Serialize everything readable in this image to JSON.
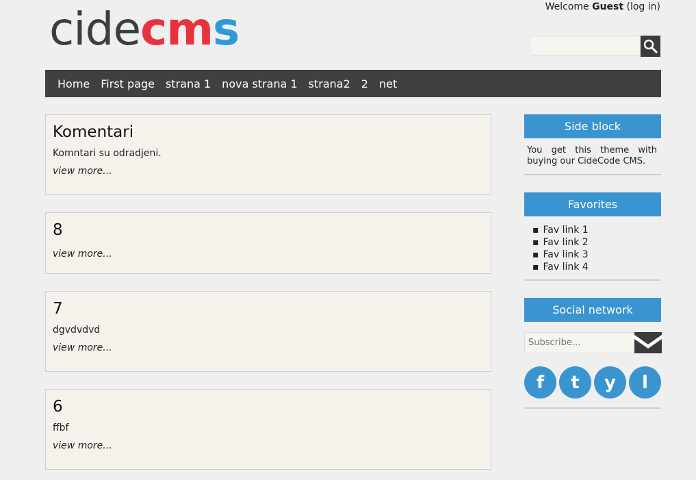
{
  "logo": {
    "part1": "cide",
    "part2": "cm",
    "part3": "s"
  },
  "user": {
    "welcome": "Welcome",
    "name": "Guest",
    "login": "(log in)"
  },
  "search": {
    "placeholder": ""
  },
  "nav": [
    "Home",
    "First page",
    "strana 1",
    "nova strana 1",
    "strana2",
    "2",
    "net"
  ],
  "posts": [
    {
      "title": "Komentari",
      "body": "Komntari su odradjeni.",
      "more": "view more..."
    },
    {
      "title": "8",
      "body": "",
      "more": "view more..."
    },
    {
      "title": "7",
      "body": "dgvdvdvd",
      "more": "view more..."
    },
    {
      "title": "6",
      "body": "ffbf",
      "more": "view more..."
    }
  ],
  "sidebar": {
    "side_block": {
      "title": "Side block",
      "text": "You get this theme with buying our CideCode CMS."
    },
    "favorites": {
      "title": "Favorites",
      "links": [
        "Fav link 1",
        "Fav link 2",
        "Fav link 3",
        "Fav link 4"
      ]
    },
    "social": {
      "title": "Social network",
      "subscribe_placeholder": "Subscribe...",
      "icons": [
        "f",
        "t",
        "y",
        "l"
      ]
    }
  },
  "colors": {
    "accent": "#3a94cf",
    "nav_bg": "#404040",
    "logo_red": "#e8323c",
    "logo_blue": "#2f9bd6"
  }
}
